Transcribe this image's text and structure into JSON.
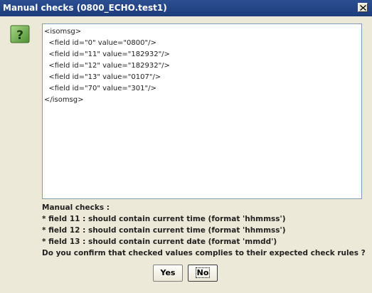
{
  "window": {
    "title": "Manual checks (0800_ECHO.test1)"
  },
  "icons": {
    "dialog": "question-icon",
    "close": "close-icon"
  },
  "colors": {
    "titlebar": "#2c4f91",
    "icon_green": "#5a9a3a",
    "background": "#ece9d8"
  },
  "message": {
    "lines": [
      "<isomsg>",
      "  <field id=\"0\" value=\"0800\"/>",
      "  <field id=\"11\" value=\"182932\"/>",
      "  <field id=\"12\" value=\"182932\"/>",
      "  <field id=\"13\" value=\"0107\"/>",
      "  <field id=\"70\" value=\"301\"/>",
      "</isomsg>"
    ]
  },
  "checks": {
    "heading": "Manual checks :",
    "items": [
      "* field 11 : should contain current time (format 'hhmmss')",
      "* field 12 : should contain current time (format 'hhmmss')",
      "* field 13 : should contain current date (format 'mmdd')"
    ],
    "question": "Do you confirm that checked values complies to their expected check rules ?"
  },
  "buttons": {
    "yes_label": "Yes",
    "no_label": "No"
  }
}
